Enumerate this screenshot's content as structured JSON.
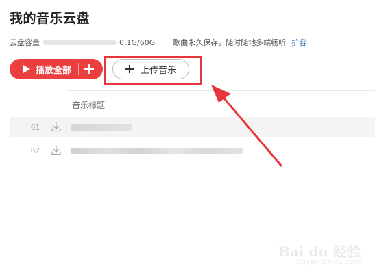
{
  "page": {
    "title": "我的音乐云盘"
  },
  "capacity": {
    "label": "云盘容量",
    "value": "0.1G/60G",
    "note": "歌曲永久保存，随时随地多端畅听",
    "expand_label": "扩容"
  },
  "toolbar": {
    "play_all_label": "播放全部",
    "upload_label": "上传音乐"
  },
  "list": {
    "column_title": "音乐标题",
    "rows": [
      {
        "index": "01"
      },
      {
        "index": "02"
      }
    ]
  },
  "icons": {
    "play": "play-icon",
    "add": "plus-icon",
    "upload": "plus-icon",
    "download": "download-icon"
  },
  "colors": {
    "accent": "#ea3e3f",
    "highlight": "#e8343c",
    "link": "#3b6fb6"
  },
  "watermark": {
    "logo": "Bai du 经验",
    "sub": "jingyan.baidu.com"
  }
}
